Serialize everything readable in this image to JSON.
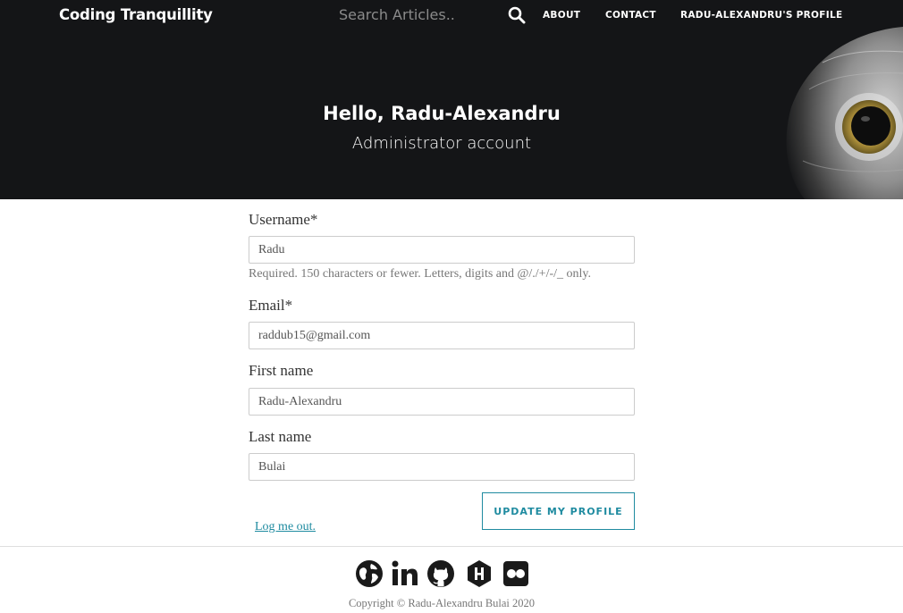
{
  "header": {
    "brand": "Coding Tranquillity",
    "search_placeholder": "Search Articles..",
    "search_icon": "search-icon",
    "nav": {
      "about": "ABOUT",
      "contact": "CONTACT",
      "profile": "RADU-ALEXANDRU'S PROFILE"
    }
  },
  "hero": {
    "greeting": "Hello, Radu-Alexandru",
    "subtitle": "Administrator account",
    "image": "owl-image"
  },
  "form": {
    "username": {
      "label": "Username*",
      "value": "Radu",
      "help": "Required. 150 characters or fewer. Letters, digits and @/./+/-/_ only."
    },
    "email": {
      "label": "Email*",
      "value": "raddub15@gmail.com"
    },
    "first_name": {
      "label": "First name",
      "value": "Radu-Alexandru"
    },
    "last_name": {
      "label": "Last name",
      "value": "Bulai"
    },
    "submit": "UPDATE MY PROFILE",
    "logout": "Log me out."
  },
  "footer": {
    "social_icons": [
      "globe-icon",
      "linkedin-icon",
      "github-icon",
      "hackerrank-icon",
      "flickr-icon"
    ],
    "copyright": "Copyright © Radu-Alexandru Bulai 2020"
  },
  "colors": {
    "header_bg": "#141517",
    "accent": "#1f8ba0",
    "footer_icon": "#1a1a1a"
  }
}
